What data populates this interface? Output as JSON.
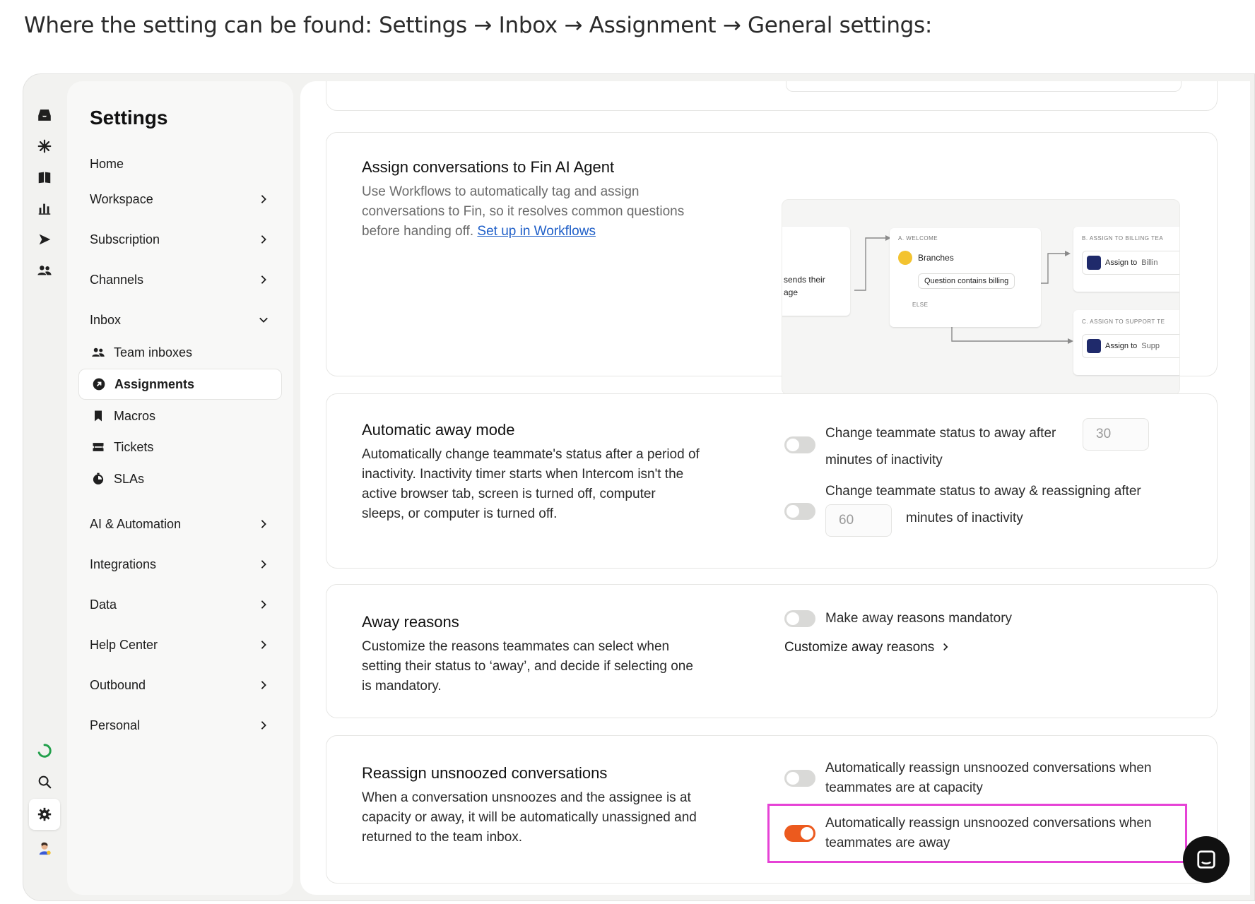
{
  "intro": "Where the setting can be found: Settings → Inbox → Assignment → General settings:",
  "rail": {
    "icons": [
      "inbox-icon",
      "fin-icon",
      "knowledge-icon",
      "reports-icon",
      "outbound-icon",
      "contacts-icon",
      "loading-icon",
      "search-icon",
      "gear-icon",
      "avatar-icon"
    ]
  },
  "sidebar": {
    "title": "Settings",
    "items": [
      {
        "label": "Home",
        "has_chevron": false
      },
      {
        "label": "Workspace",
        "has_chevron": true
      },
      {
        "label": "Subscription",
        "has_chevron": true
      },
      {
        "label": "Channels",
        "has_chevron": true
      },
      {
        "label": "Inbox",
        "has_chevron": true,
        "expanded": true
      }
    ],
    "inbox_sub": [
      {
        "label": "Team inboxes",
        "icon": "team-icon"
      },
      {
        "label": "Assignments",
        "icon": "assignment-icon",
        "active": true
      },
      {
        "label": "Macros",
        "icon": "bookmark-icon"
      },
      {
        "label": "Tickets",
        "icon": "ticket-icon"
      },
      {
        "label": "SLAs",
        "icon": "sla-icon"
      }
    ],
    "items_after": [
      {
        "label": "AI & Automation"
      },
      {
        "label": "Integrations"
      },
      {
        "label": "Data"
      },
      {
        "label": "Help Center"
      },
      {
        "label": "Outbound"
      },
      {
        "label": "Personal"
      }
    ]
  },
  "fin_card": {
    "title": "Assign conversations to Fin AI Agent",
    "desc": "Use Workflows to automatically tag and assign conversations to Fin, so it resolves common questions before handing off.",
    "link": "Set up in Workflows",
    "diagram": {
      "start_text_1": "sends their",
      "start_text_2": "age",
      "welcome_label": "A. WELCOME",
      "branches": "Branches",
      "condition": "Question contains billing",
      "else": "ELSE",
      "billing_label": "B. ASSIGN TO BILLING TEA",
      "billing_action": "Assign to",
      "billing_target": "Billin",
      "support_label": "C. ASSIGN TO SUPPORT TE",
      "support_action": "Assign to",
      "support_target": "Supp"
    }
  },
  "away_card": {
    "title": "Automatic away mode",
    "desc": "Automatically change teammate's status after a period of inactivity. Inactivity timer starts when Intercom isn't the active browser tab, screen is turned off, computer sleeps, or computer is turned off.",
    "opt1_a": "Change teammate status to away after",
    "opt1_value": "30",
    "opt1_b": "minutes of inactivity",
    "opt2_a": "Change teammate status to away & reassigning after",
    "opt2_value": "60",
    "opt2_b": "minutes of inactivity"
  },
  "reasons_card": {
    "title": "Away reasons",
    "desc": "Customize the reasons teammates can select when setting their status to ‘away’, and decide if selecting one is mandatory.",
    "opt": "Make away reasons mandatory",
    "link": "Customize away reasons"
  },
  "unsnooze_card": {
    "title": "Reassign unsnoozed conversations",
    "desc": "When a conversation unsnoozes and the assignee is at capacity or away, it will be automatically unassigned and returned to the team inbox.",
    "opt1": "Automatically reassign unsnoozed conversations when teammates are at capacity",
    "opt1_on": false,
    "opt2": "Automatically reassign unsnoozed conversations when teammates are away",
    "opt2_on": true
  },
  "colors": {
    "accent": "#ec5a1e",
    "highlight": "#e642d6",
    "link": "#1f5fc8"
  }
}
